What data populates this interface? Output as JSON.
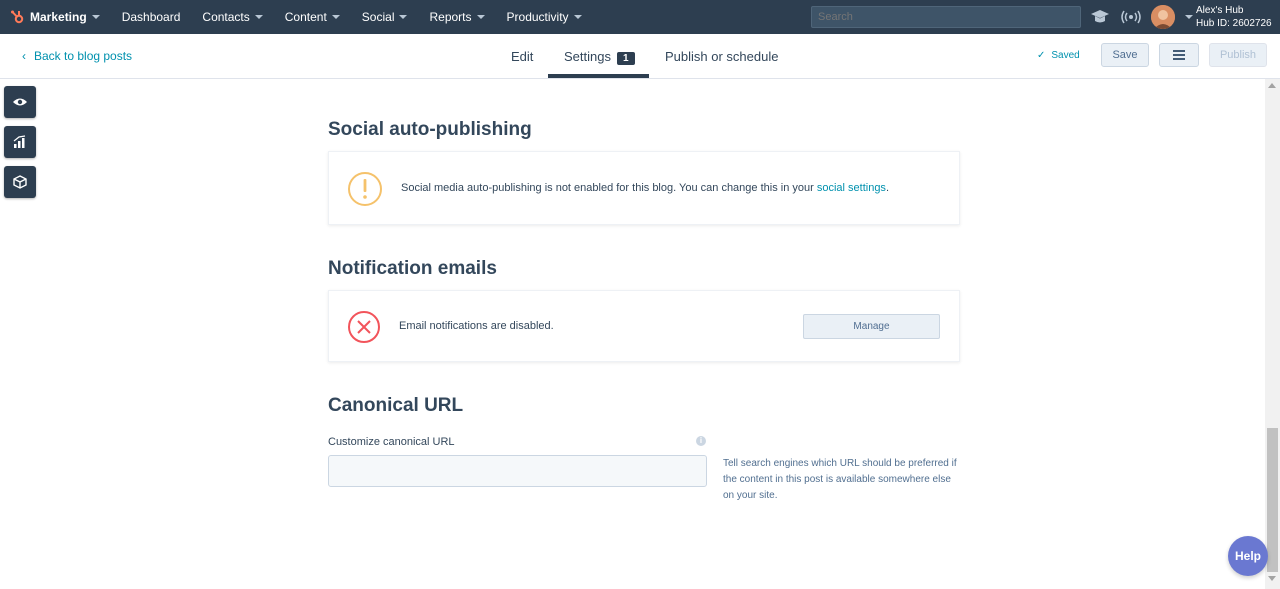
{
  "topnav": {
    "brand": "Marketing",
    "items": [
      "Dashboard",
      "Contacts",
      "Content",
      "Social",
      "Reports",
      "Productivity"
    ],
    "search_placeholder": "Search",
    "hub_name": "Alex's Hub",
    "hub_id": "Hub ID: 2602726"
  },
  "subheader": {
    "back_label": "Back to blog posts",
    "tabs": [
      {
        "label": "Edit"
      },
      {
        "label": "Settings",
        "badge": "1"
      },
      {
        "label": "Publish or schedule"
      }
    ],
    "saved_label": "Saved",
    "save_label": "Save",
    "publish_label": "Publish"
  },
  "social": {
    "heading": "Social auto-publishing",
    "message": "Social media auto-publishing is not enabled for this blog. You can change this in your ",
    "link": "social settings",
    "suffix": "."
  },
  "notifications": {
    "heading": "Notification emails",
    "message": "Email notifications are disabled.",
    "button": "Manage"
  },
  "canonical": {
    "heading": "Canonical URL",
    "field_label": "Customize canonical URL",
    "value": "",
    "help": "Tell search engines which URL should be preferred if the content in this post is available somewhere else on your site."
  },
  "help_button": "Help",
  "colors": {
    "nav_bg": "#2d3e50",
    "link": "#0091ae",
    "warning": "#f5c26b",
    "error": "#f2545b",
    "help": "#6a78d1"
  }
}
